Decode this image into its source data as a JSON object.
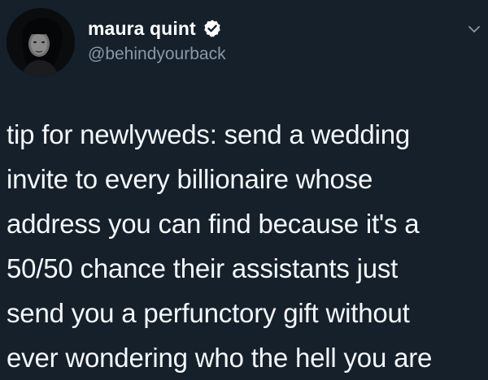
{
  "author": {
    "display_name": "maura quint",
    "handle": "@behindyourback",
    "verified": true,
    "avatar_icon": "user-avatar"
  },
  "tweet": {
    "text": "tip for newlyweds: send a wedding\ninvite to every billionaire whose\naddress you can find because it's a\n50/50 chance their assistants just\nsend you a perfunctory gift without\never wondering who the hell you are"
  },
  "colors": {
    "background": "#15202b",
    "text": "#f5f8fa",
    "secondary_text": "#8899a6",
    "verified_badge": "#ffffff"
  },
  "icons": {
    "verified": "verified-badge-icon",
    "more": "chevron-down-icon"
  }
}
